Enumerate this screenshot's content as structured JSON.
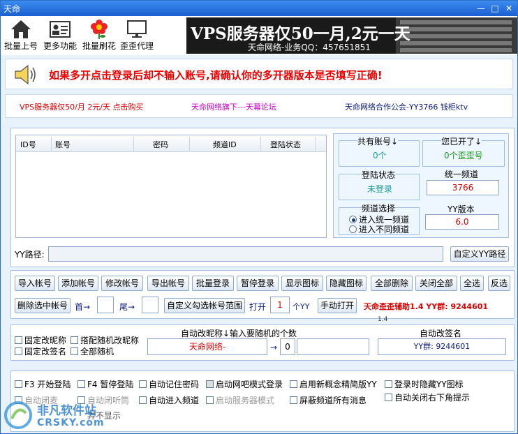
{
  "window": {
    "title": "天命",
    "min_glyph": "—",
    "max_glyph": "□",
    "close_glyph": "✕"
  },
  "toolbar": [
    {
      "label": "批量上号",
      "icon": "home-icon"
    },
    {
      "label": "更多功能",
      "icon": "id-card-icon"
    },
    {
      "label": "批量刷花",
      "icon": "flower-icon"
    },
    {
      "label": "歪歪代理",
      "icon": "monitor-icon"
    }
  ],
  "banner": {
    "headline": "VPS服务器仅50一月,2元一天",
    "subline": "天命网络-业务QQ：457651851"
  },
  "notice": {
    "text": "如果多开点击登录后却不输入账号,请确认你的多开器版本是否填写正确!"
  },
  "links": {
    "vps": "VPS服务器仅50/月 2元/天 点击购买",
    "forum": "天命网络旗下---天幕论坛",
    "guild": "天命网络合作公会-YY3766 钱柜ktv"
  },
  "grid": {
    "columns": [
      "ID号",
      "账号",
      "密码",
      "频道ID",
      "登陆状态"
    ]
  },
  "stats": {
    "total_label": "共有账号↓",
    "total_value": "0个",
    "open_label": "您已开了↓",
    "open_value": "0个歪歪号",
    "login_label": "登陆状态",
    "login_value": "未登录",
    "channel_label": "统一频道",
    "channel_value": "3766",
    "channel_select_label": "频道选择",
    "radio_same": "进入统一频道",
    "radio_diff": "进入不同频道",
    "yy_version_label": "YY版本",
    "yy_version_value": "6.0"
  },
  "path": {
    "label": "YY路径:",
    "value": "",
    "custom_button": "自定义YY路径"
  },
  "actions_row1": [
    "导入帐号",
    "添加帐号",
    "修改帐号",
    "导出帐号",
    "批量登录",
    "暂停登录",
    "显示图标",
    "隐藏图标",
    "全部删除",
    "关闭全部",
    "全选",
    "反选"
  ],
  "actions_row2": {
    "delete_selected": "删除选中帐号",
    "first_label": "首→",
    "first_value": "",
    "tail_label": "尾→",
    "tail_value": "",
    "custom_range": "自定义勾选帐号范围",
    "open_label": "打开",
    "open_value": "1",
    "open_unit": "个YY",
    "manual_open": "手动打开",
    "promo": "天命歪歪辅助1.4 YY群: 9244601",
    "version_small": "1.4"
  },
  "nick": {
    "fixed_nick": "固定改昵称",
    "random_nick": "搭配随机改昵称",
    "fixed_sign": "固定改签名",
    "all_random": "全部随机",
    "auto_nick_label": "自动改昵称↓输入要随机的个数",
    "nick_value": "天命网络-",
    "arrow": "→",
    "count_value": "0",
    "extra_value": "",
    "auto_sign_label": "自动改签名",
    "sign_value": "YY群: 9244601"
  },
  "options": {
    "f3": "F3 开始登陆",
    "f4": "F4 暂停登陆",
    "remember_pwd": "自动记住密码",
    "netbar": "启动网吧模式登录",
    "new_concept": "启用新概念精简版YY",
    "hide_icon": "登录时隐藏YY图标",
    "auto_mute": "自动闭麦",
    "auto_listen": "自动闭听筒",
    "auto_channel": "自动进入频道",
    "server_mode": "启动服务器模式",
    "block_msg": "屏蔽频道所有消息",
    "auto_close_tip": "自动关闭右下角提示",
    "third_row": "弄不显示"
  },
  "watermark": {
    "cn": "非凡软件站",
    "en": "CRSKY.com"
  }
}
